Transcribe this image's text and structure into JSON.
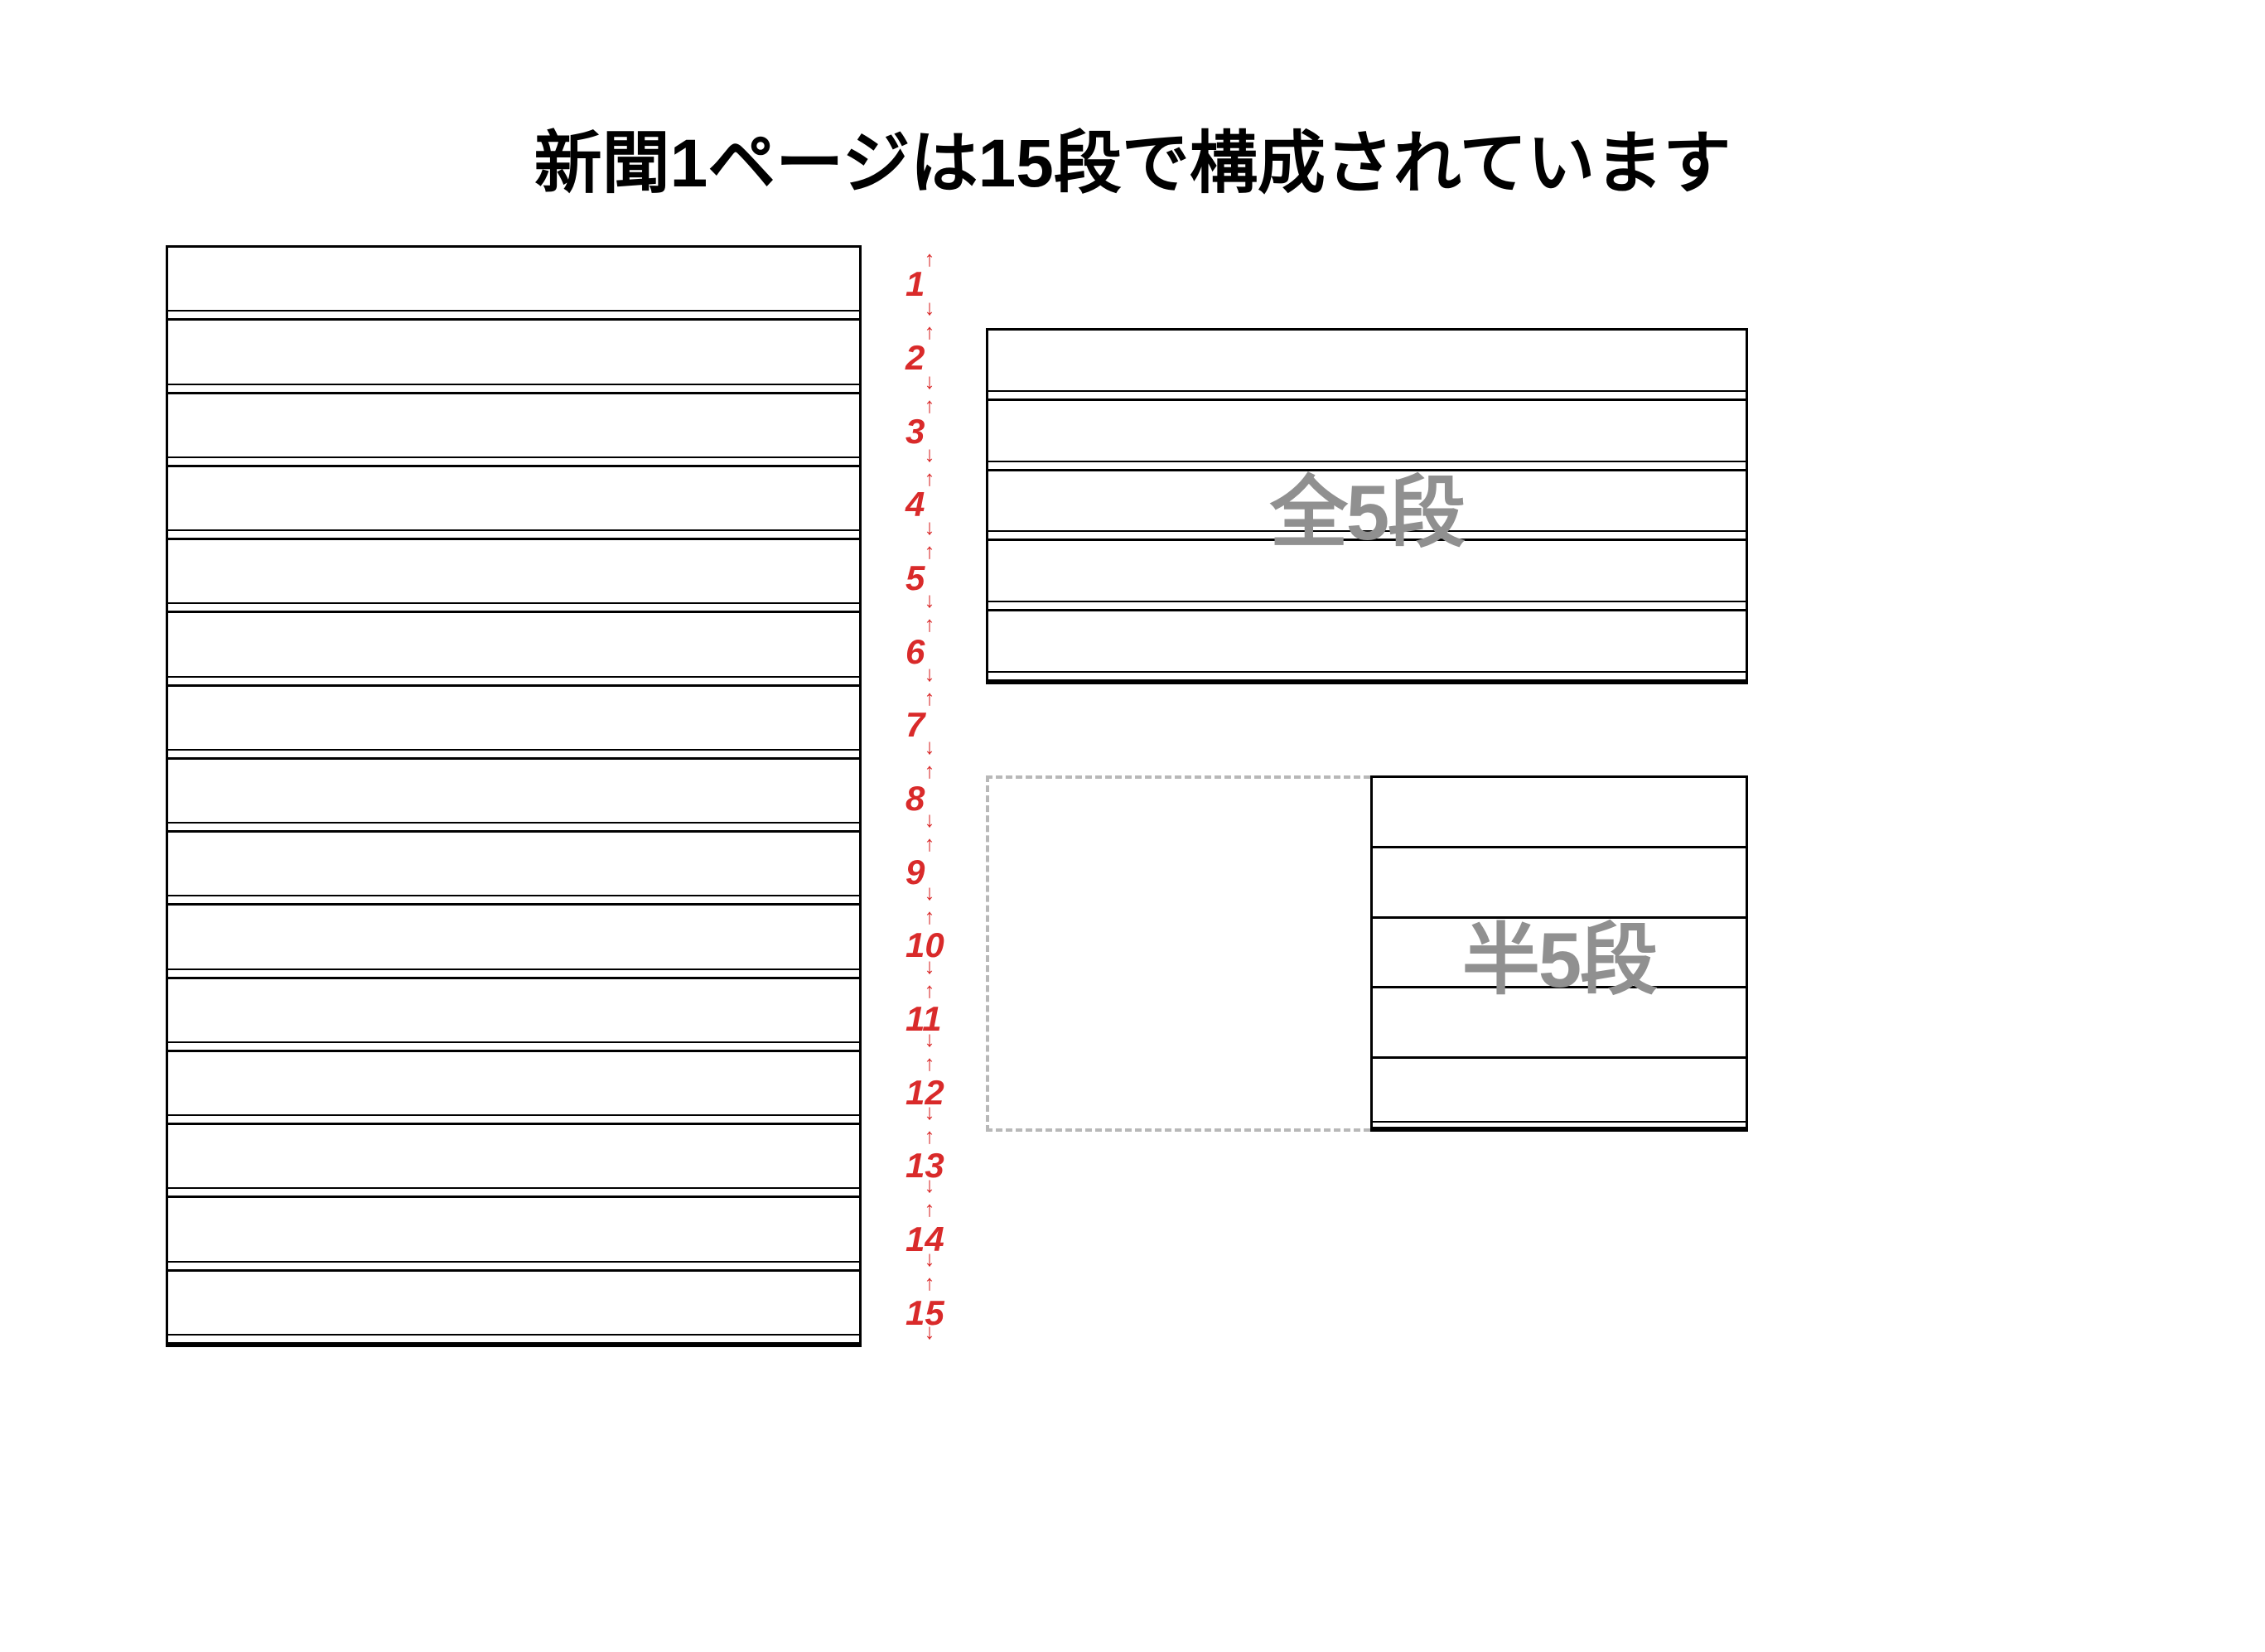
{
  "title": "新聞1ページは15段で構成されています",
  "main_grid": {
    "dan_count": 15,
    "numbers": [
      "1",
      "2",
      "3",
      "4",
      "5",
      "6",
      "7",
      "8",
      "9",
      "10",
      "11",
      "12",
      "13",
      "14",
      "15"
    ]
  },
  "full5": {
    "label": "全5段",
    "rows": 5
  },
  "half5": {
    "label": "半5段",
    "rows": 5
  },
  "arrow_glyphs": {
    "up": "↑",
    "down": "↓"
  },
  "accent_color": "#d92a2a"
}
